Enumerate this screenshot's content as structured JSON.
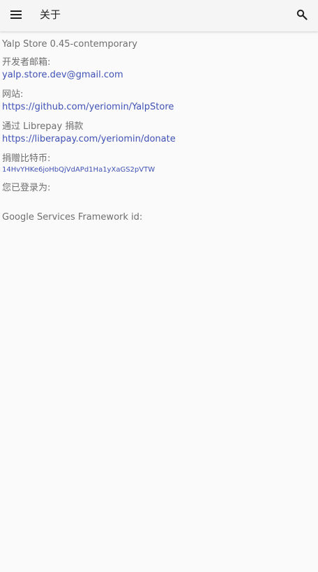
{
  "toolbar": {
    "title": "关于",
    "menu_icon": "menu-icon",
    "search_icon": "search-icon"
  },
  "about": {
    "app_version": "Yalp Store 0.45-contemporary",
    "developer_email_label": "开发者邮箱:",
    "developer_email": "yalp.store.dev@gmail.com",
    "website_label": "网站:",
    "website_url": "https://github.com/yeriomin/YalpStore",
    "librepay_label": "通过 Librepay 捐款",
    "librepay_url": "https://liberapay.com/yeriomin/donate",
    "bitcoin_label": "捐赠比特币:",
    "bitcoin_address": "14HvYHKe6joHbQjVdAPd1Ha1yXaGS2pVTW",
    "logged_in_label": "您已登录为:",
    "gsf_label": "Google Services Framework id:"
  },
  "colors": {
    "link": "#3f51b5",
    "text": "#6e6e6e",
    "title": "#212121",
    "background": "#fafafa"
  }
}
